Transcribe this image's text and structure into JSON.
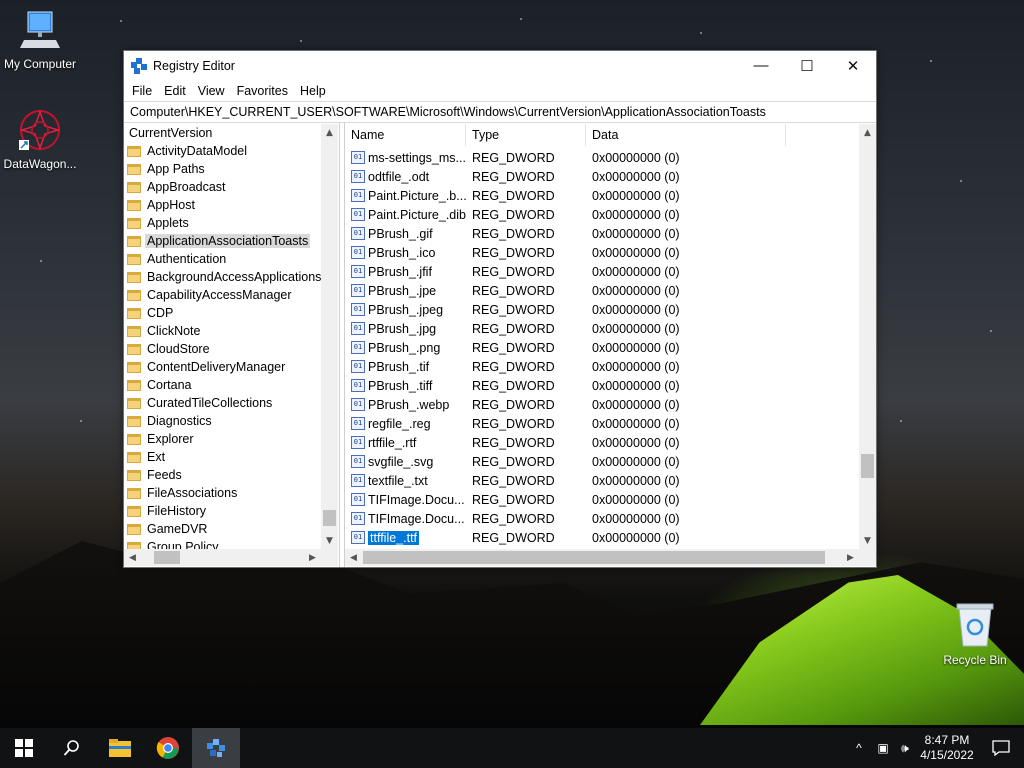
{
  "desktop": {
    "icons": [
      {
        "label": "My Computer"
      },
      {
        "label": "DataWagon..."
      },
      {
        "label": "Recycle Bin"
      }
    ]
  },
  "window": {
    "title": "Registry Editor",
    "menu": [
      "File",
      "Edit",
      "View",
      "Favorites",
      "Help"
    ],
    "address": "Computer\\HKEY_CURRENT_USER\\SOFTWARE\\Microsoft\\Windows\\CurrentVersion\\ApplicationAssociationToasts",
    "caption": {
      "minimize": "—",
      "maximize": "☐",
      "close": "✕"
    }
  },
  "tree": {
    "root": "CurrentVersion",
    "items": [
      "ActivityDataModel",
      "App Paths",
      "AppBroadcast",
      "AppHost",
      "Applets",
      "ApplicationAssociationToasts",
      "Authentication",
      "BackgroundAccessApplications",
      "CapabilityAccessManager",
      "CDP",
      "ClickNote",
      "CloudStore",
      "ContentDeliveryManager",
      "Cortana",
      "CuratedTileCollections",
      "Diagnostics",
      "Explorer",
      "Ext",
      "Feeds",
      "FileAssociations",
      "FileHistory",
      "GameDVR",
      "Group Policy"
    ],
    "selected_index": 5
  },
  "list": {
    "columns": [
      "Name",
      "Type",
      "Data"
    ],
    "rows": [
      {
        "name": "ms-settings_ms...",
        "type": "REG_DWORD",
        "data": "0x00000000 (0)"
      },
      {
        "name": "odtfile_.odt",
        "type": "REG_DWORD",
        "data": "0x00000000 (0)"
      },
      {
        "name": "Paint.Picture_.b...",
        "type": "REG_DWORD",
        "data": "0x00000000 (0)"
      },
      {
        "name": "Paint.Picture_.dib",
        "type": "REG_DWORD",
        "data": "0x00000000 (0)"
      },
      {
        "name": "PBrush_.gif",
        "type": "REG_DWORD",
        "data": "0x00000000 (0)"
      },
      {
        "name": "PBrush_.ico",
        "type": "REG_DWORD",
        "data": "0x00000000 (0)"
      },
      {
        "name": "PBrush_.jfif",
        "type": "REG_DWORD",
        "data": "0x00000000 (0)"
      },
      {
        "name": "PBrush_.jpe",
        "type": "REG_DWORD",
        "data": "0x00000000 (0)"
      },
      {
        "name": "PBrush_.jpeg",
        "type": "REG_DWORD",
        "data": "0x00000000 (0)"
      },
      {
        "name": "PBrush_.jpg",
        "type": "REG_DWORD",
        "data": "0x00000000 (0)"
      },
      {
        "name": "PBrush_.png",
        "type": "REG_DWORD",
        "data": "0x00000000 (0)"
      },
      {
        "name": "PBrush_.tif",
        "type": "REG_DWORD",
        "data": "0x00000000 (0)"
      },
      {
        "name": "PBrush_.tiff",
        "type": "REG_DWORD",
        "data": "0x00000000 (0)"
      },
      {
        "name": "PBrush_.webp",
        "type": "REG_DWORD",
        "data": "0x00000000 (0)"
      },
      {
        "name": "regfile_.reg",
        "type": "REG_DWORD",
        "data": "0x00000000 (0)"
      },
      {
        "name": "rtffile_.rtf",
        "type": "REG_DWORD",
        "data": "0x00000000 (0)"
      },
      {
        "name": "svgfile_.svg",
        "type": "REG_DWORD",
        "data": "0x00000000 (0)"
      },
      {
        "name": "textfile_.txt",
        "type": "REG_DWORD",
        "data": "0x00000000 (0)"
      },
      {
        "name": "TIFImage.Docu...",
        "type": "REG_DWORD",
        "data": "0x00000000 (0)"
      },
      {
        "name": "TIFImage.Docu...",
        "type": "REG_DWORD",
        "data": "0x00000000 (0)"
      },
      {
        "name": "ttffile_.ttf",
        "type": "REG_DWORD",
        "data": "0x00000000 (0)"
      }
    ],
    "selected_index": 20,
    "value_icon": "reg-binary-icon"
  },
  "taskbar": {
    "apps": [
      "start-icon",
      "search-icon",
      "file-explorer-icon",
      "chrome-icon",
      "regedit-icon"
    ],
    "active_app": "regedit-icon",
    "clock": {
      "time": "8:47 PM",
      "date": "4/15/2022"
    },
    "tray": {
      "chevron": "^",
      "network": "▣",
      "volume": "🕪"
    }
  },
  "colors": {
    "selection": "#0078d7",
    "tree_selection": "#d9d9d9",
    "taskbar": "#111214"
  }
}
